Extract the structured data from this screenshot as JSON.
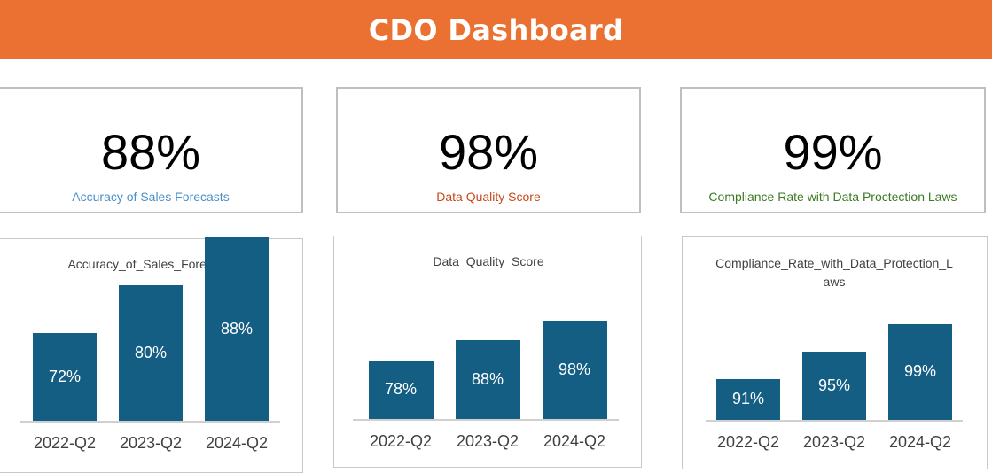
{
  "header": {
    "title": "CDO Dashboard",
    "background": "#eb7132"
  },
  "kpis": [
    {
      "value": "88%",
      "label": "Accuracy of Sales Forecasts",
      "label_color": "#4a90c9"
    },
    {
      "value": "98%",
      "label": "Data Quality Score",
      "label_color": "#c6491b"
    },
    {
      "value": "99%",
      "label": "Compliance Rate with Data Proctection Laws",
      "label_color": "#3d7a24"
    }
  ],
  "chart_data": [
    {
      "type": "bar",
      "title": "Accuracy_of_Sales_Forecasts",
      "categories": [
        "2022-Q2",
        "2023-Q2",
        "2024-Q2"
      ],
      "values": [
        72,
        80,
        88
      ],
      "labels": [
        "72%",
        "80%",
        "88%"
      ],
      "color": "#145e83",
      "grid": false
    },
    {
      "type": "bar",
      "title": "Data_Quality_Score",
      "categories": [
        "2022-Q2",
        "2023-Q2",
        "2024-Q2"
      ],
      "values": [
        78,
        88,
        98
      ],
      "labels": [
        "78%",
        "88%",
        "98%"
      ],
      "color": "#145e83",
      "grid": false
    },
    {
      "type": "bar",
      "title": "Compliance_Rate_with_Data_Protection_Laws",
      "categories": [
        "2022-Q2",
        "2023-Q2",
        "2024-Q2"
      ],
      "values": [
        91,
        95,
        99
      ],
      "labels": [
        "91%",
        "95%",
        "99%"
      ],
      "color": "#145e83",
      "grid": false
    }
  ]
}
